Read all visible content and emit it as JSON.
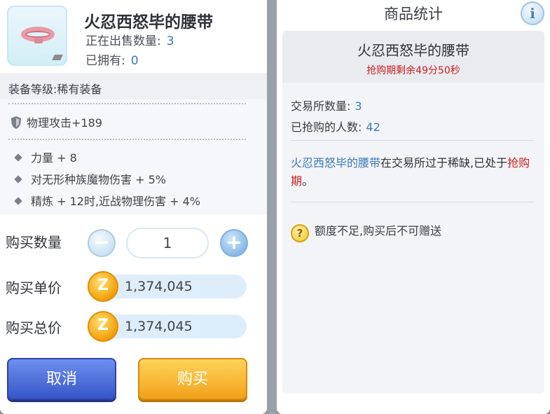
{
  "item": {
    "name": "火忍西怒毕的腰带",
    "on_sale_label": "正在出售数量:",
    "on_sale_value": "3",
    "owned_label": "已拥有:",
    "owned_value": "0"
  },
  "description": {
    "grade": "装备等级:稀有装备",
    "attack": "物理攻击+189",
    "stats": [
      "力量 + 8",
      "对无形种族魔物伤害 + 5%",
      "精炼 + 12时,近战物理伤害 + 4%"
    ]
  },
  "purchase": {
    "qty_label": "购买数量",
    "qty_value": "1",
    "unit_price_label": "购买单价",
    "unit_price": "1,374,045",
    "total_price_label": "购买总价",
    "total_price": "1,374,045",
    "currency_icon_text": "Z",
    "cancel_label": "取消",
    "buy_label": "购买"
  },
  "stats_panel": {
    "title": "商品统计",
    "info_icon_text": "i",
    "item_name": "火忍西怒毕的腰带",
    "timer": "抢购期剩余49分50秒",
    "exchange_count_label": "交易所数量:",
    "exchange_count": "3",
    "buyers_label": "已抢购的人数:",
    "buyers": "42",
    "scarcity_item": "火忍西怒毕的腰带",
    "scarcity_text": "在交易所过于稀缺,已处于",
    "scarcity_period": "抢购期",
    "scarcity_end": "。",
    "warning_icon_text": "?",
    "warning": "额度不足,购买后不可赠送"
  },
  "colors": {
    "accent_blue": "#3a79b8",
    "alert_red": "#cc1f1f",
    "cancel_button": "#3656c8",
    "buy_button": "#f2a21a"
  }
}
